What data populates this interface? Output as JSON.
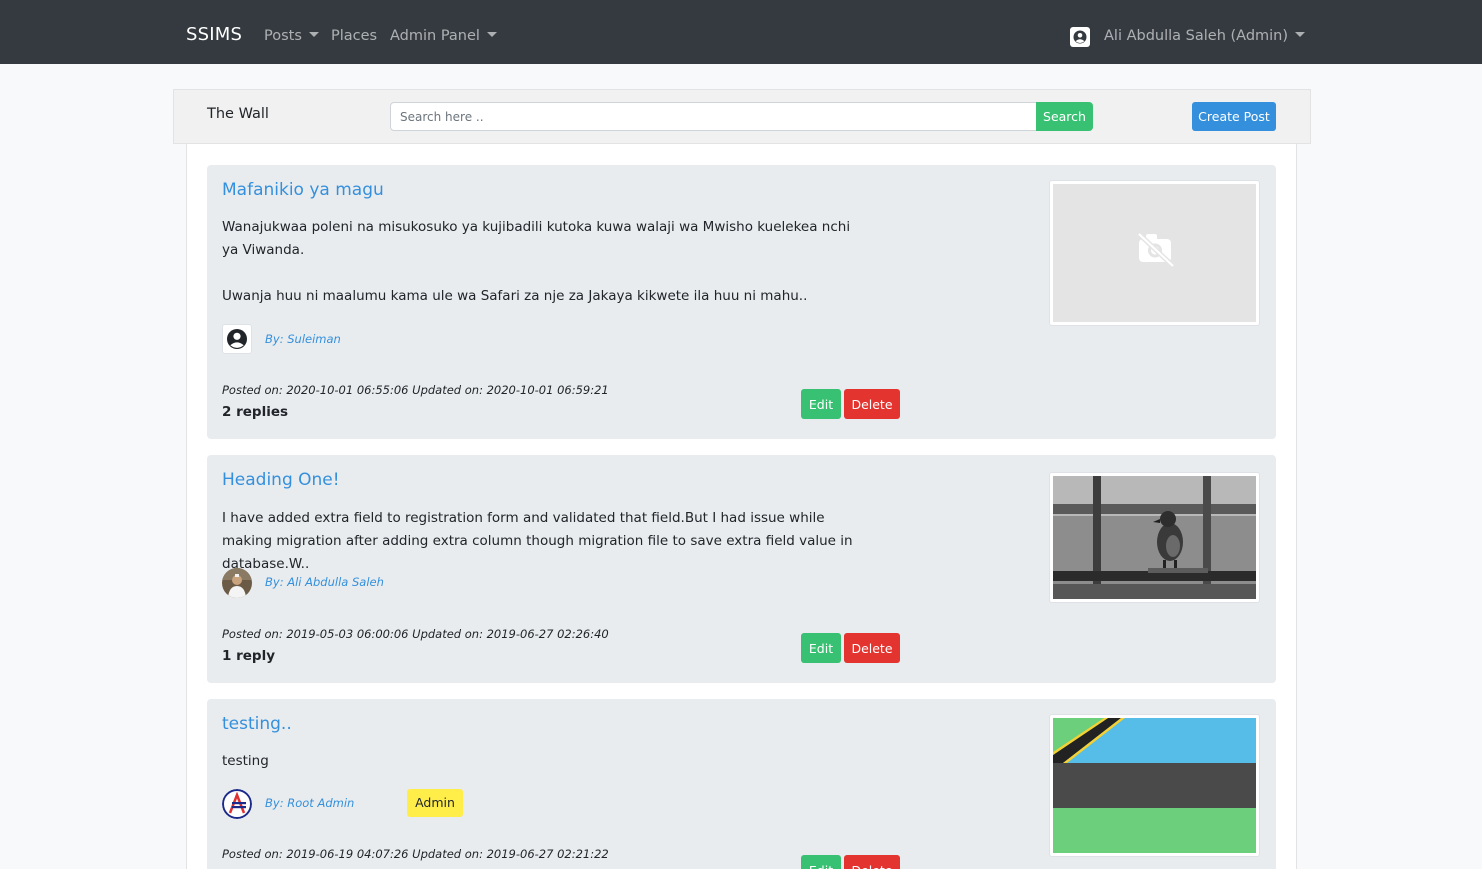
{
  "navbar": {
    "brand": "SSIMS",
    "links": [
      {
        "label": "Posts",
        "dropdown": true
      },
      {
        "label": "Places",
        "dropdown": false
      },
      {
        "label": "Admin Panel",
        "dropdown": true
      }
    ],
    "user": {
      "name": "Ali Abdulla Saleh (Admin)",
      "avatar_icon": "user-circle-icon"
    }
  },
  "wall": {
    "title": "The Wall",
    "search_placeholder": "Search here ..",
    "search_label": "Search",
    "create_label": "Create Post"
  },
  "posts": [
    {
      "title": "Mafanikio ya magu",
      "body": "Wanajukwaa poleni na misukosuko ya kujibadili kutoka kuwa walaji wa Mwisho kuelekea nchi ya Viwanda.\n\nUwanja huu ni maalumu kama ule wa Safari za nje za Jakaya kikwete ila huu ni mahu..",
      "author": "By: Suleiman",
      "meta": "Posted on: 2020-10-01 06:55:06 Updated on: 2020-10-01 06:59:21",
      "replies": "2 replies",
      "edit_label": "Edit",
      "delete_label": "Delete",
      "image": "no-image-icon"
    },
    {
      "title": "Heading One!",
      "body": "I have added extra field to registration form and validated that field.But I had issue while making migration after adding extra column though migration file to save extra field value in database.W..",
      "author": "By: Ali Abdulla Saleh",
      "meta": "Posted on: 2019-05-03 06:00:06 Updated on: 2019-06-27 02:26:40",
      "replies": "1 reply",
      "edit_label": "Edit",
      "delete_label": "Delete",
      "image": "bird-photo"
    },
    {
      "title": "testing..",
      "body": "testing",
      "author": "By: Root Admin",
      "badge": "Admin",
      "meta": "Posted on: 2019-06-19 04:07:26 Updated on: 2019-06-27 02:21:22",
      "edit_label": "Edit",
      "delete_label": "Delete",
      "image": "tanzania-flag"
    }
  ],
  "colors": {
    "navbar": "#343a40",
    "primary": "#3490dc",
    "success": "#38c172",
    "danger": "#e3342f",
    "warning": "#ffed4a",
    "card": "#e9ecef"
  }
}
